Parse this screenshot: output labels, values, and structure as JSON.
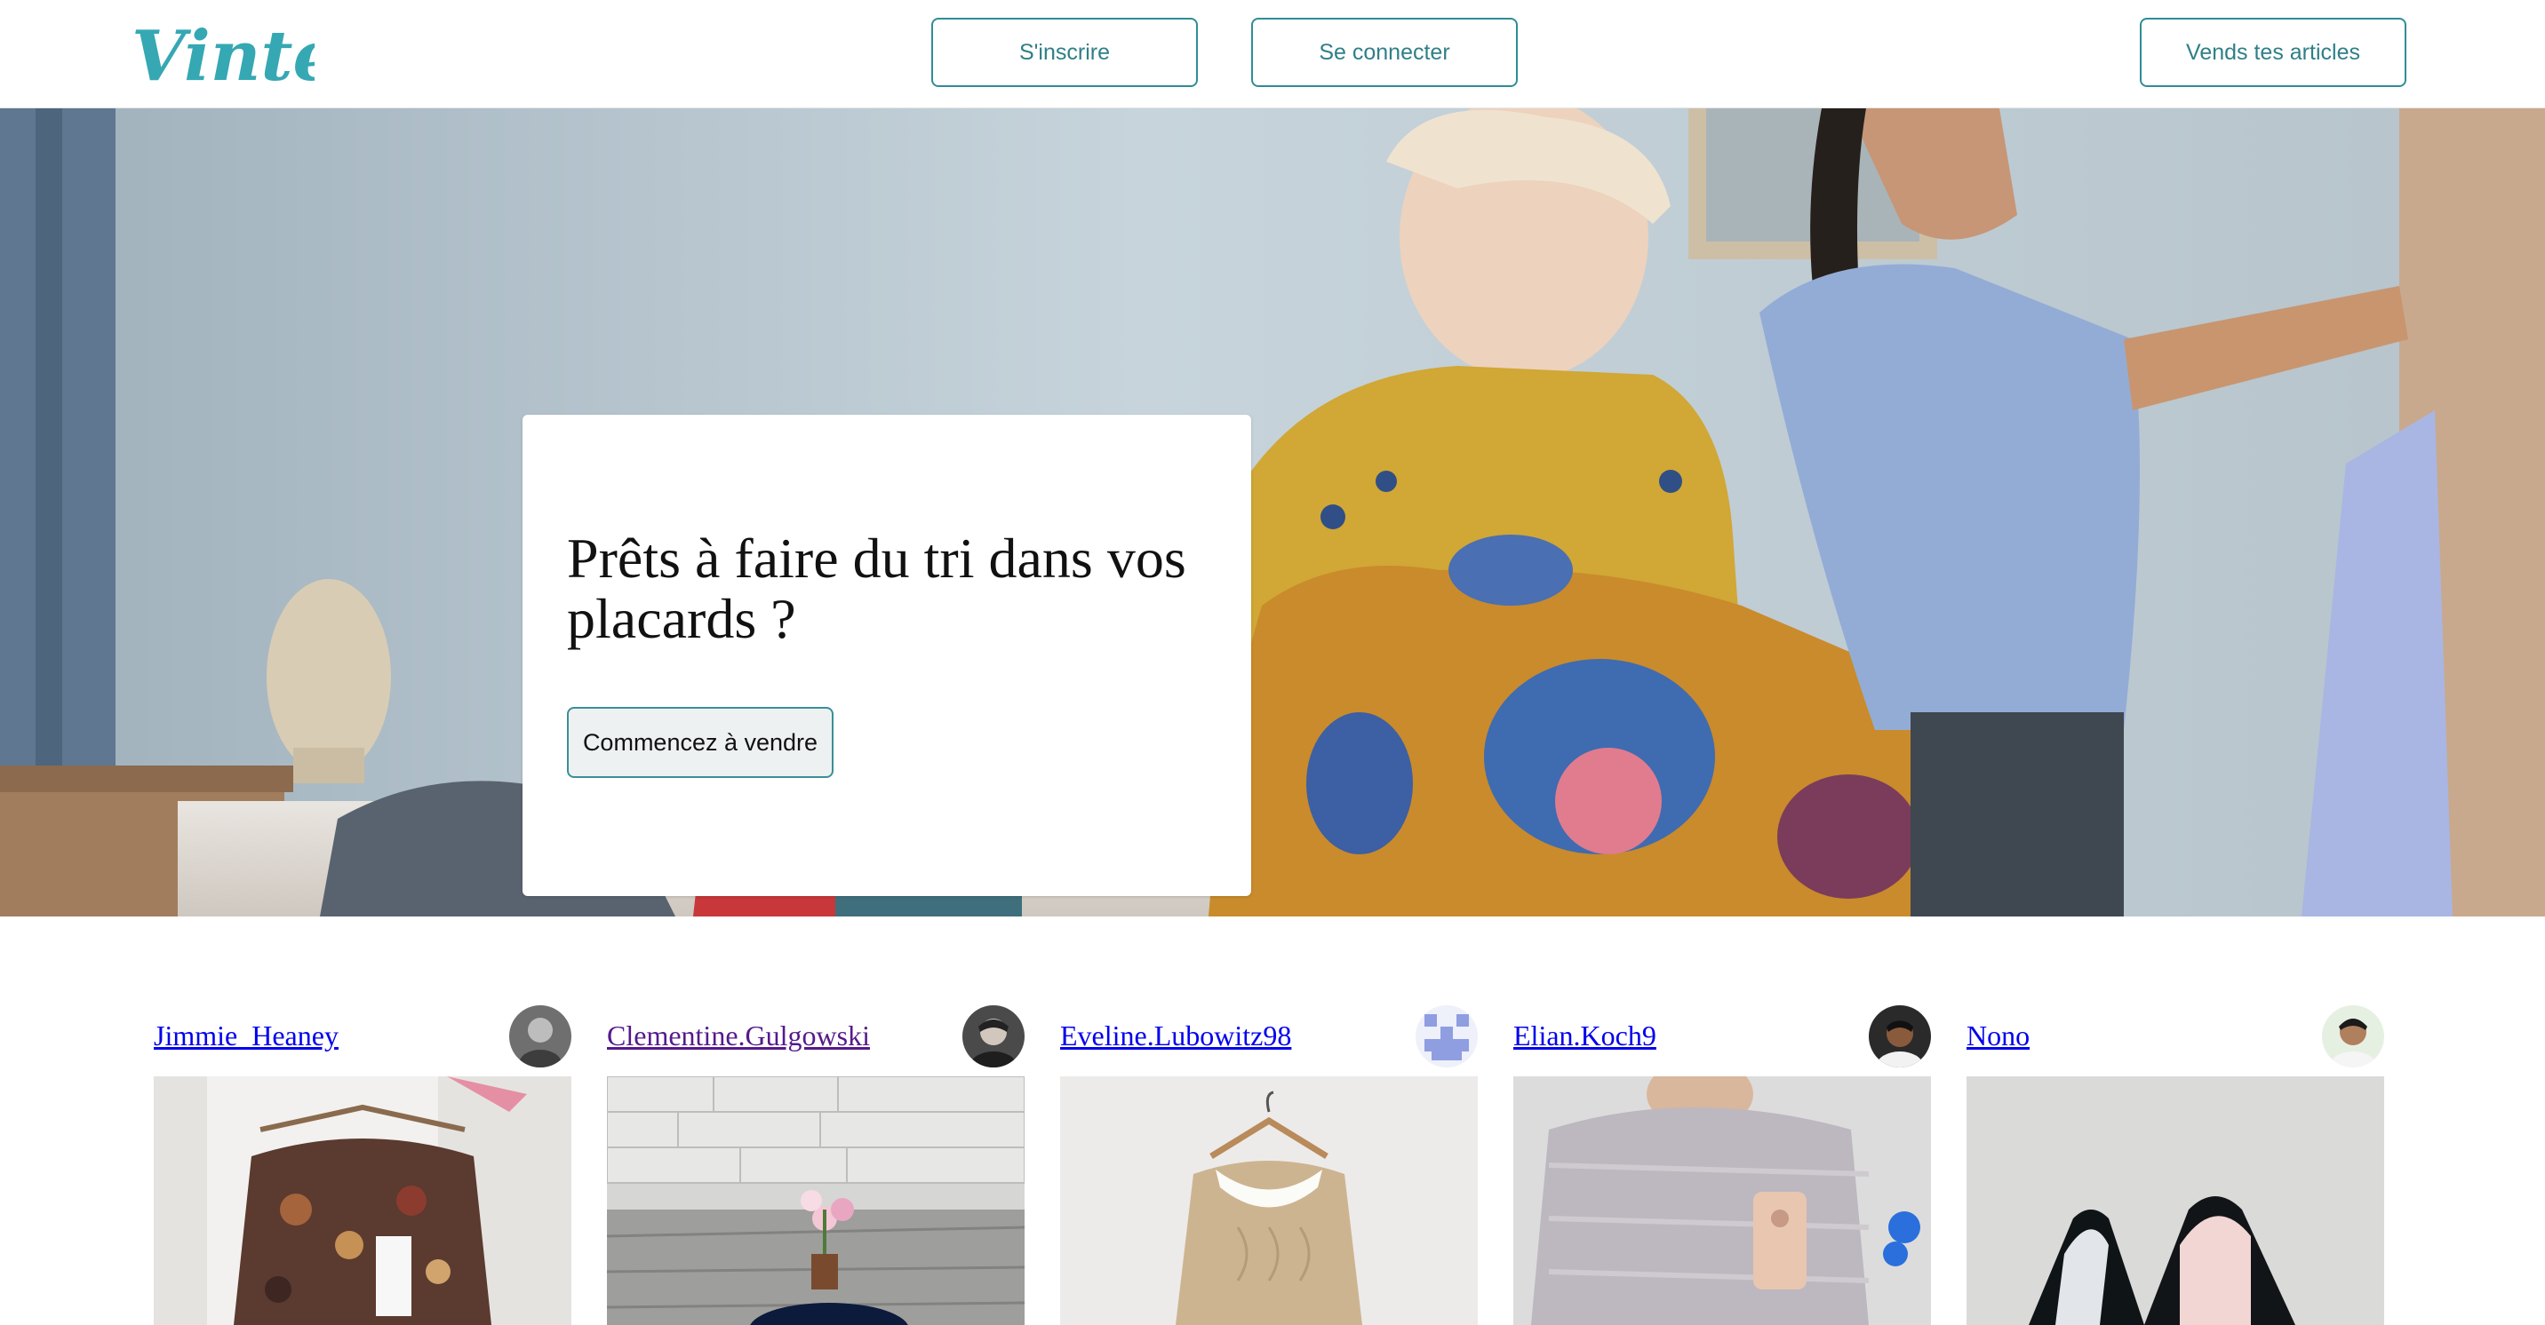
{
  "header": {
    "logo_text": "Vinted",
    "signup_label": "S'inscrire",
    "login_label": "Se connecter",
    "sell_label": "Vends tes articles"
  },
  "hero": {
    "title": "Prêts à faire du tri dans vos placards ?",
    "cta_label": "Commencez à vendre"
  },
  "feed": {
    "items": [
      {
        "username": "Jimmie_Heaney",
        "visited": false
      },
      {
        "username": "Clementine.Gulgowski",
        "visited": true
      },
      {
        "username": "Eveline.Lubowitz98",
        "visited": false
      },
      {
        "username": "Elian.Koch9",
        "visited": false
      },
      {
        "username": "Nono",
        "visited": false
      }
    ]
  },
  "colors": {
    "brand": "#09b1ba",
    "button_border": "#2f8d97",
    "link": "#0000ee",
    "link_visited": "#551a8b"
  }
}
